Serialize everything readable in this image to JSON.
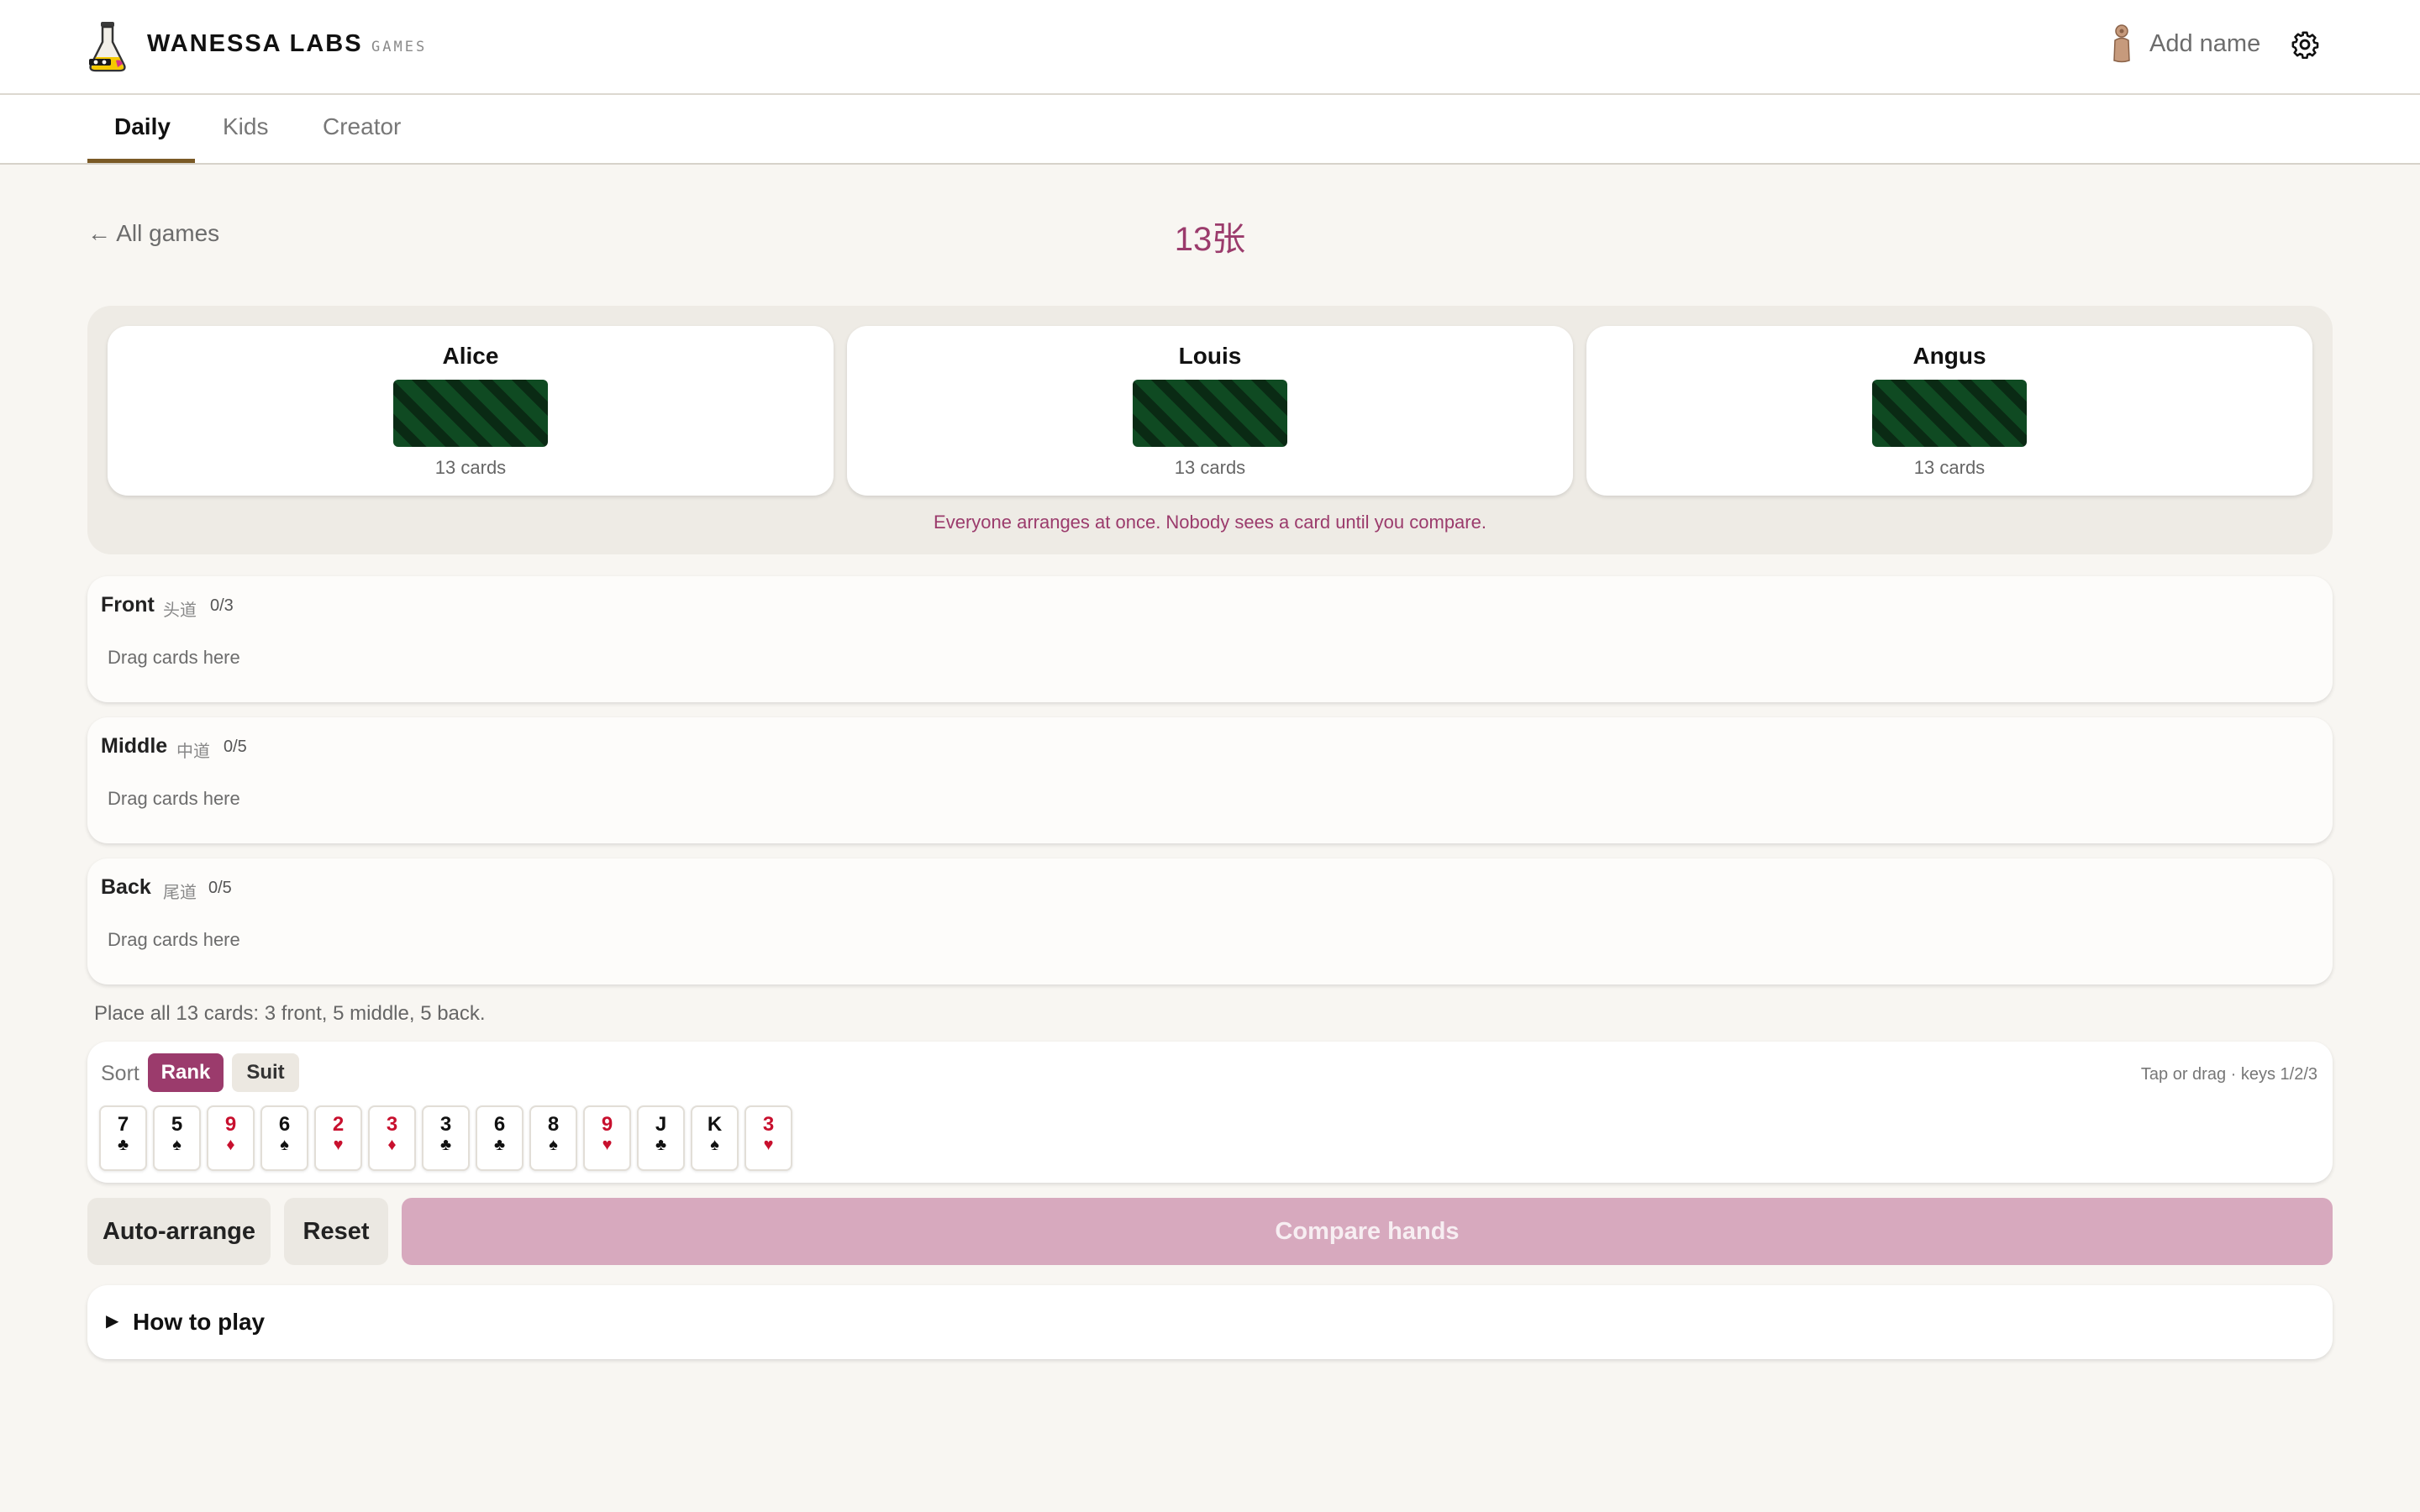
{
  "header": {
    "brand": "WANESSA LABS",
    "brand_sub": "GAMES",
    "add_name": "Add name",
    "icons": [
      "flask-logo-icon",
      "person-icon",
      "gear-icon"
    ]
  },
  "tabs": [
    {
      "label": "Daily",
      "active": true
    },
    {
      "label": "Kids",
      "active": false
    },
    {
      "label": "Creator",
      "active": false
    }
  ],
  "nav": {
    "back_label": "← All games"
  },
  "game": {
    "title": "13张"
  },
  "players": [
    {
      "name": "Alice",
      "cards": "13 cards"
    },
    {
      "name": "Louis",
      "cards": "13 cards"
    },
    {
      "name": "Angus",
      "cards": "13 cards"
    }
  ],
  "notice": "Everyone arranges at once. Nobody sees a card until you compare.",
  "rows": [
    {
      "name": "Front",
      "cn": "头道",
      "count": "0/3",
      "hint": "Drag cards here"
    },
    {
      "name": "Middle",
      "cn": "中道",
      "count": "0/5",
      "hint": "Drag cards here"
    },
    {
      "name": "Back",
      "cn": "尾道",
      "count": "0/5",
      "hint": "Drag cards here"
    }
  ],
  "place_hint": "Place all 13 cards: 3 front, 5 middle, 5 back.",
  "hand": {
    "sort_label": "Sort",
    "sort_rank": "Rank",
    "sort_suit": "Suit",
    "active_sort": "Rank",
    "keys_hint": "Tap or drag · keys 1/2/3",
    "cards": [
      {
        "rank": "7",
        "suit": "♣",
        "color": "black"
      },
      {
        "rank": "5",
        "suit": "♠",
        "color": "black"
      },
      {
        "rank": "9",
        "suit": "♦",
        "color": "red"
      },
      {
        "rank": "6",
        "suit": "♠",
        "color": "black"
      },
      {
        "rank": "2",
        "suit": "♥",
        "color": "red"
      },
      {
        "rank": "3",
        "suit": "♦",
        "color": "red"
      },
      {
        "rank": "3",
        "suit": "♣",
        "color": "black"
      },
      {
        "rank": "6",
        "suit": "♣",
        "color": "black"
      },
      {
        "rank": "8",
        "suit": "♠",
        "color": "black"
      },
      {
        "rank": "9",
        "suit": "♥",
        "color": "red"
      },
      {
        "rank": "J",
        "suit": "♣",
        "color": "black"
      },
      {
        "rank": "K",
        "suit": "♠",
        "color": "black"
      },
      {
        "rank": "3",
        "suit": "♥",
        "color": "red"
      }
    ]
  },
  "actions": {
    "auto": "Auto-arrange",
    "reset": "Reset",
    "compare": "Compare hands"
  },
  "howto": {
    "label": "How to play"
  },
  "colors": {
    "accent": "#9b3b6c",
    "compare_disabled": "#d7a9be",
    "background": "#f8f6f2",
    "card_back": "#0f4a22",
    "red_suit": "#c8102e",
    "tab_underline": "#7a5a26"
  }
}
